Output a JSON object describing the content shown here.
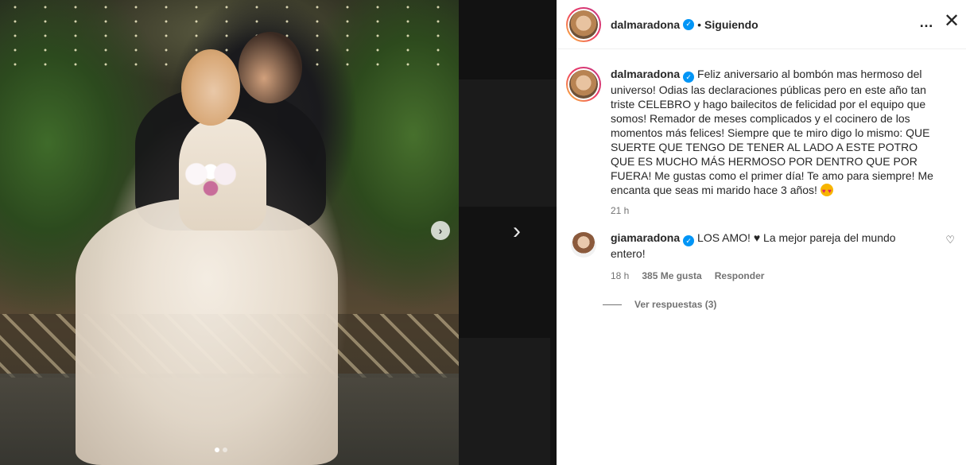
{
  "header": {
    "username": "dalmaradona",
    "follow_status": "Siguiendo",
    "separator": "•",
    "more_icon": "…",
    "close_icon": "✕"
  },
  "caption": {
    "username": "dalmaradona",
    "text": "Feliz aniversario al bombón mas hermoso del universo! Odias las declaraciones públicas pero en este año tan triste CELEBRO y hago bailecitos de felicidad por el equipo que somos! Remador de meses complicados y el cocinero de los momentos más felices! Siempre que te miro digo lo mismo: QUE SUERTE QUE TENGO DE TENER AL LADO A ESTE POTRO QUE ES MUCHO MÁS HERMOSO POR DENTRO QUE POR FUERA! Me gustas como el primer día! Te amo para siempre! Me encanta que seas mi marido hace 3 años!",
    "emoji": "heart-eyes-emoji",
    "time": "21 h"
  },
  "comments": [
    {
      "username": "giamaradona",
      "text": "LOS AMO! ♥ La mejor pareja del mundo entero!",
      "time": "18 h",
      "likes": "385 Me gusta",
      "reply_label": "Responder",
      "heart_icon": "♡"
    }
  ],
  "replies": {
    "label": "Ver respuestas (3)"
  },
  "carousel": {
    "next_photo_glyph": "›",
    "gallery_next_glyph": "›",
    "dots": 2,
    "active_dot": 0
  },
  "colors": {
    "verified": "#0095f6",
    "story_ring_start": "#f9c33c",
    "story_ring_end": "#c13584",
    "meta_text": "#737373"
  }
}
